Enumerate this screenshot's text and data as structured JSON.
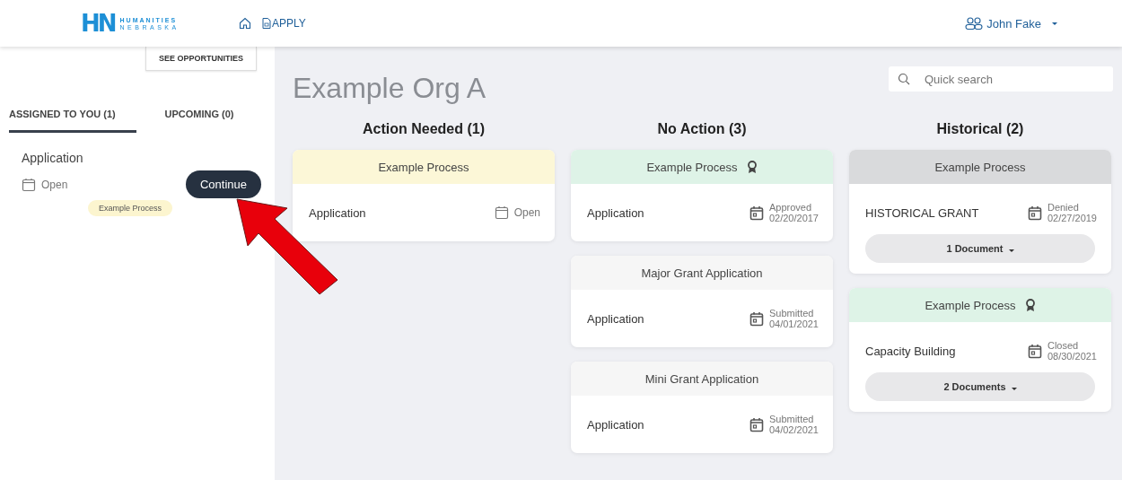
{
  "header": {
    "logo": {
      "mark": "HN",
      "line1": "HUMANITIES",
      "line2": "NEBRASKA"
    },
    "nav": [
      {
        "kind": "home"
      },
      {
        "kind": "apply",
        "label": "APPLY"
      }
    ],
    "user": {
      "name": "John Fake"
    }
  },
  "sidebar": {
    "opportunities_button": "SEE OPPORTUNITIES",
    "tabs": [
      {
        "label": "ASSIGNED TO YOU (1)",
        "selected": true
      },
      {
        "label": "UPCOMING (0)",
        "selected": false
      }
    ],
    "items": [
      {
        "title": "Application",
        "status": "Open",
        "button": "Continue",
        "tag": "Example Process"
      }
    ]
  },
  "main": {
    "title": "Example Org A",
    "search": {
      "placeholder": "Quick search"
    },
    "columns": [
      {
        "heading": "Action Needed (1)",
        "cards": [
          {
            "header": "Example Process",
            "color": "#fcf7d7",
            "awarded": false,
            "name": "Application",
            "kind": "open",
            "status": "Open"
          }
        ]
      },
      {
        "heading": "No Action (3)",
        "cards": [
          {
            "header": "Example Process",
            "color": "#def3e7",
            "awarded": true,
            "name": "Application",
            "kind": "dated",
            "status": "Approved",
            "date": "02/20/2017"
          },
          {
            "header": "Major Grant Application",
            "color": "#f6f6f6",
            "awarded": false,
            "name": "Application",
            "kind": "dated",
            "status": "Submitted",
            "date": "04/01/2021"
          },
          {
            "header": "Mini Grant Application",
            "color": "#f6f6f6",
            "awarded": false,
            "name": "Application",
            "kind": "dated",
            "status": "Submitted",
            "date": "04/02/2021"
          }
        ]
      },
      {
        "heading": "Historical (2)",
        "cards": [
          {
            "header": "Example Process",
            "color": "#d9dadc",
            "awarded": false,
            "name": "HISTORICAL GRANT",
            "kind": "dated",
            "status": "Denied",
            "date": "02/27/2019",
            "documents": "1 Document"
          },
          {
            "header": "Example Process",
            "color": "#def3e7",
            "awarded": true,
            "name": "Capacity Building",
            "kind": "dated",
            "status": "Closed",
            "date": "08/30/2021",
            "documents": "2 Documents"
          }
        ]
      }
    ]
  },
  "annotation": {
    "kind": "arrow"
  }
}
